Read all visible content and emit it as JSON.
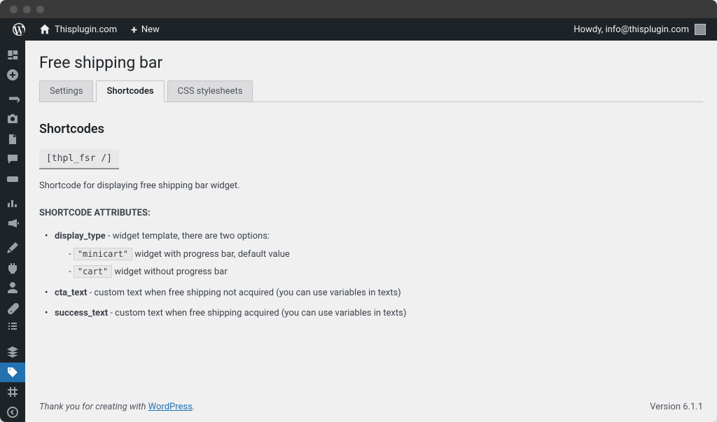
{
  "topbar": {
    "site_name": "Thisplugin.com",
    "new_label": "New",
    "howdy": "Howdy, info@thisplugin.com"
  },
  "page": {
    "title": "Free shipping bar",
    "tabs": [
      {
        "label": "Settings",
        "active": false
      },
      {
        "label": "Shortcodes",
        "active": true
      },
      {
        "label": "CSS stylesheets",
        "active": false
      }
    ],
    "section_title": "Shortcodes",
    "shortcode": "[thpl_fsr /]",
    "shortcode_desc": "Shortcode for displaying free shipping bar widget.",
    "attr_heading": "SHORTCODE ATTRIBUTES:",
    "attrs": {
      "display_type": {
        "name": "display_type",
        "desc": " - widget template, there are two options:",
        "opts": [
          {
            "code": "\"minicart\"",
            "text": " widget with progress bar, default value"
          },
          {
            "code": "\"cart\"",
            "text": " widget without progress bar"
          }
        ]
      },
      "cta_text": {
        "name": "cta_text",
        "desc": " - custom text when free shipping not acquired (you can use variables in texts)"
      },
      "success_text": {
        "name": "success_text",
        "desc": " - custom text when free shipping acquired (you can use variables in texts)"
      }
    }
  },
  "footer": {
    "thanks_pre": "Thank you for creating with ",
    "wp": "WordPress",
    "version": "Version 6.1.1"
  }
}
